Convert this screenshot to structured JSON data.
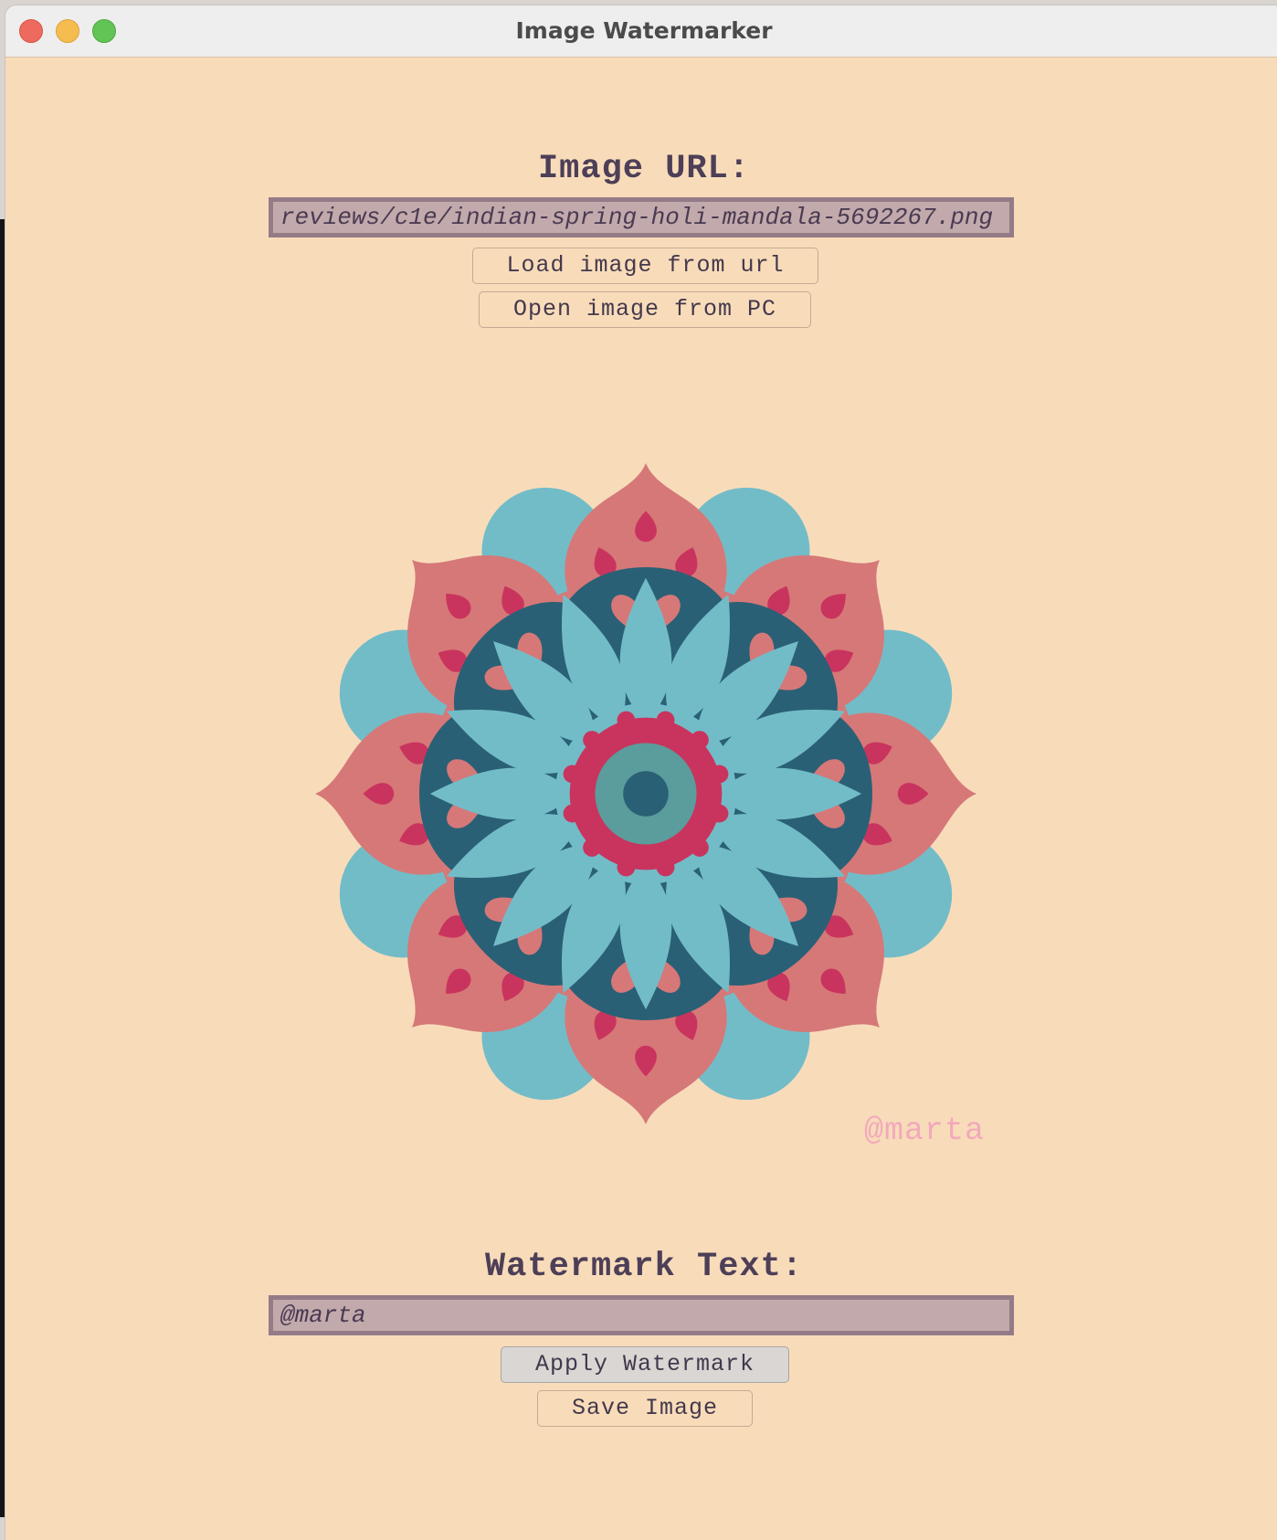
{
  "window": {
    "title": "Image Watermarker"
  },
  "url_section": {
    "label": "Image URL:",
    "value": "reviews/c1e/indian-spring-holi-mandala-5692267.png",
    "load_button": "Load image from url",
    "open_button": "Open image from PC"
  },
  "preview": {
    "watermark_overlay": "@marta"
  },
  "watermark_section": {
    "label": "Watermark Text:",
    "value": "@marta",
    "apply_button": "Apply Watermark",
    "save_button": "Save Image"
  },
  "colors": {
    "background": "#f8dcba",
    "field_bg": "#c2a9ab",
    "text": "#4d3f57",
    "mandala_blue": "#72bcc8",
    "mandala_pink": "#d67878",
    "mandala_red": "#c9345e",
    "mandala_teal": "#2a6075",
    "watermark": "#f2a9bb"
  }
}
